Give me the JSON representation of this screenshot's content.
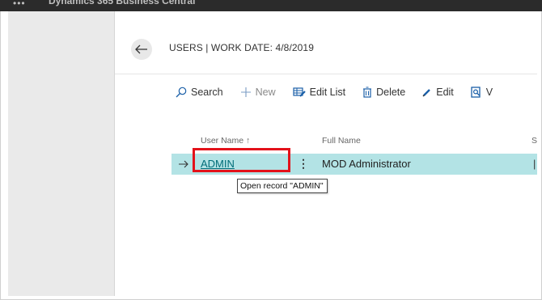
{
  "window": {
    "app_name": "Dynamics 365 Business Central",
    "waffle_glyph": "•••"
  },
  "header": {
    "title": "USERS | WORK DATE: 4/8/2019"
  },
  "actions": [
    {
      "label": "Search",
      "icon": "search-icon"
    },
    {
      "label": "New",
      "icon": "plus-icon"
    },
    {
      "label": "Edit List",
      "icon": "edit-list-icon"
    },
    {
      "label": "Delete",
      "icon": "trash-icon"
    },
    {
      "label": "Edit",
      "icon": "pencil-icon"
    },
    {
      "label": "V",
      "icon": "view-icon"
    }
  ],
  "table": {
    "columns": [
      "User Name ↑",
      "Full Name",
      "S"
    ],
    "rows": [
      {
        "user_name": "ADMIN",
        "full_name": "MOD Administrator",
        "state_edge": "|",
        "menu_glyph": "⋮"
      }
    ]
  },
  "tooltip": "Open record \"ADMIN\"",
  "colors": {
    "accent": "#006c78",
    "row_selected": "#b3e3e5",
    "highlight": "#e3121a",
    "topbar": "#2b2b2b"
  }
}
